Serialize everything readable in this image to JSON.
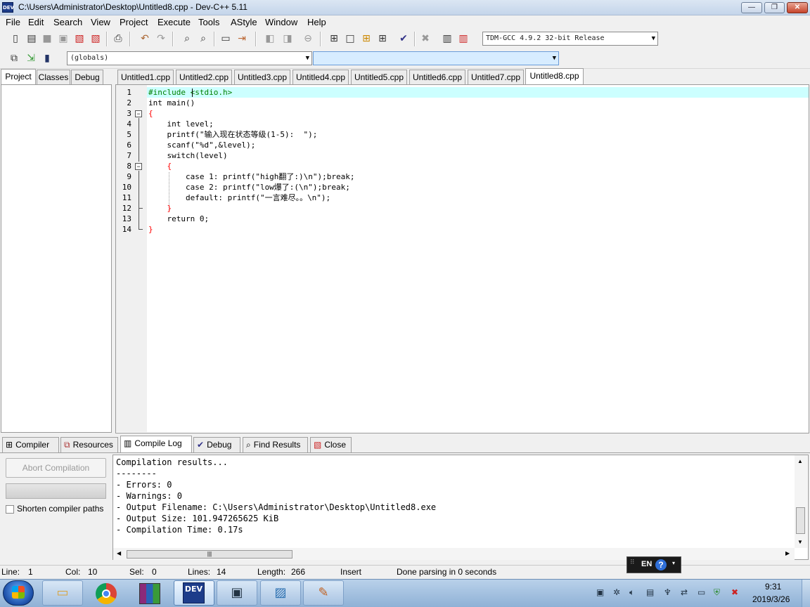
{
  "window": {
    "title": "C:\\Users\\Administrator\\Desktop\\Untitled8.cpp - Dev-C++ 5.11",
    "app_icon_text": "DEV"
  },
  "window_controls": {
    "minimize": "—",
    "maximize": "❐",
    "close": "✕"
  },
  "menu": [
    "File",
    "Edit",
    "Search",
    "View",
    "Project",
    "Execute",
    "Tools",
    "AStyle",
    "Window",
    "Help"
  ],
  "toolbar": {
    "compiler_select": "TDM-GCC 4.9.2 32-bit Release",
    "scope_select": "(globals)",
    "function_select": ""
  },
  "left_tabs": [
    "Project",
    "Classes",
    "Debug"
  ],
  "editor_tabs": [
    "Untitled1.cpp",
    "Untitled2.cpp",
    "Untitled3.cpp",
    "Untitled4.cpp",
    "Untitled5.cpp",
    "Untitled6.cpp",
    "Untitled7.cpp",
    "Untitled8.cpp"
  ],
  "active_editor_tab": "Untitled8.cpp",
  "line_numbers": [
    "1",
    "2",
    "3",
    "4",
    "5",
    "6",
    "7",
    "8",
    "9",
    "10",
    "11",
    "12",
    "13",
    "14"
  ],
  "code": [
    "#include <stdio.h>",
    "int main()",
    "{",
    "    int level;",
    "    printf(\"输入现在状态等级(1-5):  \");",
    "    scanf(\"%d\",&level);",
    "    switch(level)",
    "    {",
    "        case 1: printf(\"high翻了:)\\n\");break;",
    "        case 2: printf(\"low爆了:(\\n\");break;",
    "        default: printf(\"一言难尽。。\\n\");",
    "    }",
    "    return 0;",
    "}"
  ],
  "bottom_tabs": [
    "Compiler",
    "Resources",
    "Compile Log",
    "Debug",
    "Find Results",
    "Close"
  ],
  "active_bottom_tab": "Compile Log",
  "compile_panel": {
    "abort_button": "Abort Compilation",
    "shorten_paths_label": "Shorten compiler paths",
    "shorten_paths_checked": false
  },
  "compile_log": [
    "Compilation results...",
    "--------",
    "- Errors: 0",
    "- Warnings: 0",
    "- Output Filename: C:\\Users\\Administrator\\Desktop\\Untitled8.exe",
    "- Output Size: 101.947265625 KiB",
    "- Compilation Time: 0.17s"
  ],
  "status": {
    "line_label": "Line:",
    "line": "1",
    "col_label": "Col:",
    "col": "10",
    "sel_label": "Sel:",
    "sel": "0",
    "lines_label": "Lines:",
    "lines": "14",
    "length_label": "Length:",
    "length": "266",
    "mode": "Insert",
    "message": "Done parsing in 0 seconds"
  },
  "ime": {
    "lang": "EN",
    "help": "?"
  },
  "taskbar": {
    "apps": [
      "explorer-icon",
      "chrome-icon",
      "winrar-icon",
      "devcpp-icon",
      "notepad-icon",
      "photo-viewer-icon",
      "paint-icon"
    ],
    "time": "9:31",
    "date": "2019/3/26"
  }
}
